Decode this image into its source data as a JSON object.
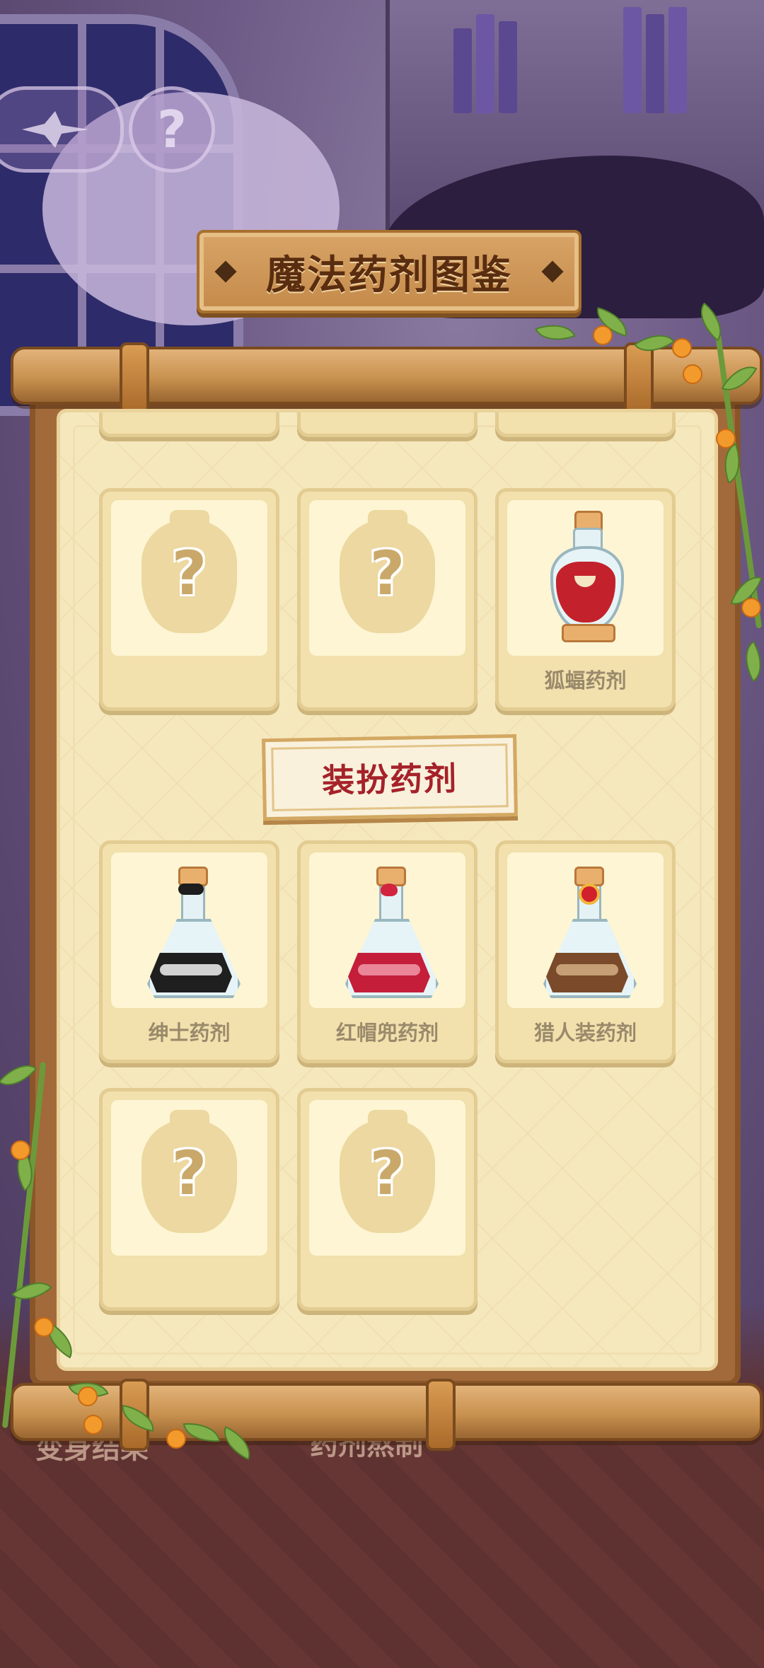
{
  "title": "魔法药剂图鉴",
  "hud": {
    "help_symbol": "?"
  },
  "top_row_partial": [
    {},
    {},
    {}
  ],
  "row1": [
    {
      "name": "",
      "unlocked": false,
      "icon": "mystery-potion-icon"
    },
    {
      "name": "",
      "unlocked": false,
      "icon": "mystery-potion-icon"
    },
    {
      "name": "狐蝠药剂",
      "unlocked": true,
      "icon": "red-vase-potion-icon"
    }
  ],
  "section": {
    "title": "装扮药剂"
  },
  "row2": [
    {
      "name": "绅士药剂",
      "unlocked": true,
      "icon": "black-flask-potion-icon",
      "liquid_color": "#1f1f1f"
    },
    {
      "name": "红帽兜药剂",
      "unlocked": true,
      "icon": "red-flask-potion-icon",
      "liquid_color": "#c41e3a"
    },
    {
      "name": "猎人装药剂",
      "unlocked": true,
      "icon": "brown-flask-potion-icon",
      "liquid_color": "#7a4a2a"
    }
  ],
  "row3": [
    {
      "name": "",
      "unlocked": false,
      "icon": "mystery-potion-icon"
    },
    {
      "name": "",
      "unlocked": false,
      "icon": "mystery-potion-icon"
    }
  ],
  "mystery_symbol": "?",
  "background": {
    "left_label": "变身结果",
    "center_label": "药剂熬制"
  },
  "colors": {
    "title_text": "#5a2d10",
    "section_text": "#a5222a",
    "card_label": "#9a8a6b",
    "paper": "#f6e8bd",
    "wood": "#c8914f"
  }
}
